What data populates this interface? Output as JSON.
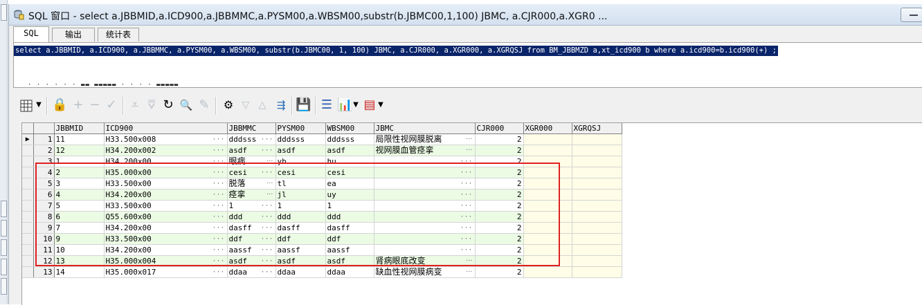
{
  "window": {
    "title": "SQL 窗口 - select a.JBBMID,a.ICD900,a.JBBMMC,a.PYSM00,a.WBSM00,substr(b.JBMC00,1,100) JBMC, a.CJR000,a.XGR0 ..."
  },
  "tabs": [
    {
      "label": "SQL"
    },
    {
      "label": "输出"
    },
    {
      "label": "统计表"
    }
  ],
  "editor": {
    "sql_text": "select a.JBBMID, a.ICD900, a.JBBMMC, a.PYSM00, a.WBSM00, substr(b.JBMC00, 1, 100) JBMC,   a.CJR000, a.XGR000, a.XGRQSJ  from BM_JBBMZD a,xt_icd900 b where a.icd900=b.icd900(+) ;"
  },
  "colors": {
    "selection": "#0a246a",
    "even_row": "#ebfbe4",
    "highlight_box": "#e02020",
    "yellow_cell": "#fffde7"
  },
  "toolbar": {
    "icons": [
      "grid-icon",
      "lock-icon",
      "add-row-icon",
      "delete-row-icon",
      "post-icon",
      "filter-icon",
      "clear-filter-icon",
      "refresh-icon",
      "find-icon",
      "clear-icon",
      "query-icon",
      "next-icon",
      "previous-icon",
      "export-icon",
      "save-icon",
      "stack-icon",
      "chart-icon",
      "table-icon"
    ]
  },
  "grid": {
    "columns": [
      "JBBMID",
      "ICD900",
      "JBBMMC",
      "PYSM00",
      "WBSM00",
      "JBMC",
      "CJR000",
      "XGR000",
      "XGRQSJ"
    ],
    "rows": [
      {
        "n": "1",
        "JBBMID": "11",
        "ICD900": "H33.500x008",
        "JBBMMC": "dddsss",
        "PYSM00": "dddsss",
        "WBSM00": "dddsss",
        "JBMC": "局限性视网膜脱离",
        "CJR000": "2",
        "XGR000": "",
        "XGRQSJ": ""
      },
      {
        "n": "2",
        "JBBMID": "12",
        "ICD900": "H34.200x002",
        "JBBMMC": "asdf",
        "PYSM00": "asdf",
        "WBSM00": "asdf",
        "JBMC": "视网膜血管痉挛",
        "CJR000": "2",
        "XGR000": "",
        "XGRQSJ": ""
      },
      {
        "n": "3",
        "JBBMID": "1",
        "ICD900": "H34.200x00",
        "JBBMMC": "眼病",
        "PYSM00": "yb",
        "WBSM00": "hu",
        "JBMC": "",
        "CJR000": "2",
        "XGR000": "",
        "XGRQSJ": ""
      },
      {
        "n": "4",
        "JBBMID": "2",
        "ICD900": "H35.000x00",
        "JBBMMC": "cesi",
        "PYSM00": "cesi",
        "WBSM00": "cesi",
        "JBMC": "",
        "CJR000": "2",
        "XGR000": "",
        "XGRQSJ": ""
      },
      {
        "n": "5",
        "JBBMID": "3",
        "ICD900": "H33.500x00",
        "JBBMMC": "脱落",
        "PYSM00": "tl",
        "WBSM00": "ea",
        "JBMC": "",
        "CJR000": "2",
        "XGR000": "",
        "XGRQSJ": ""
      },
      {
        "n": "6",
        "JBBMID": "4",
        "ICD900": "H34.200x00",
        "JBBMMC": "痉挛",
        "PYSM00": "jl",
        "WBSM00": "uy",
        "JBMC": "",
        "CJR000": "2",
        "XGR000": "",
        "XGRQSJ": ""
      },
      {
        "n": "7",
        "JBBMID": "5",
        "ICD900": "H33.500x00",
        "JBBMMC": "1",
        "PYSM00": "1",
        "WBSM00": "1",
        "JBMC": "",
        "CJR000": "2",
        "XGR000": "",
        "XGRQSJ": ""
      },
      {
        "n": "8",
        "JBBMID": "6",
        "ICD900": "Q55.600x00",
        "JBBMMC": "ddd",
        "PYSM00": "ddd",
        "WBSM00": "ddd",
        "JBMC": "",
        "CJR000": "2",
        "XGR000": "",
        "XGRQSJ": ""
      },
      {
        "n": "9",
        "JBBMID": "7",
        "ICD900": "H34.200x00",
        "JBBMMC": "dasff",
        "PYSM00": "dasff",
        "WBSM00": "dasff",
        "JBMC": "",
        "CJR000": "2",
        "XGR000": "",
        "XGRQSJ": ""
      },
      {
        "n": "10",
        "JBBMID": "9",
        "ICD900": "H33.500x00",
        "JBBMMC": "ddf",
        "PYSM00": "ddf",
        "WBSM00": "ddf",
        "JBMC": "",
        "CJR000": "2",
        "XGR000": "",
        "XGRQSJ": ""
      },
      {
        "n": "11",
        "JBBMID": "10",
        "ICD900": "H34.200x00",
        "JBBMMC": "aassf",
        "PYSM00": "aassf",
        "WBSM00": "aassf",
        "JBMC": "",
        "CJR000": "2",
        "XGR000": "",
        "XGRQSJ": ""
      },
      {
        "n": "12",
        "JBBMID": "13",
        "ICD900": "H35.000x004",
        "JBBMMC": "asdf",
        "PYSM00": "asdf",
        "WBSM00": "asdf",
        "JBMC": "肾病眼底改变",
        "CJR000": "2",
        "XGR000": "",
        "XGRQSJ": ""
      },
      {
        "n": "13",
        "JBBMID": "14",
        "ICD900": "H35.000x017",
        "JBBMMC": "ddaa",
        "PYSM00": "ddaa",
        "WBSM00": "ddaa",
        "JBMC": "缺血性视网膜病变",
        "CJR000": "2",
        "XGR000": "",
        "XGRQSJ": ""
      }
    ]
  }
}
